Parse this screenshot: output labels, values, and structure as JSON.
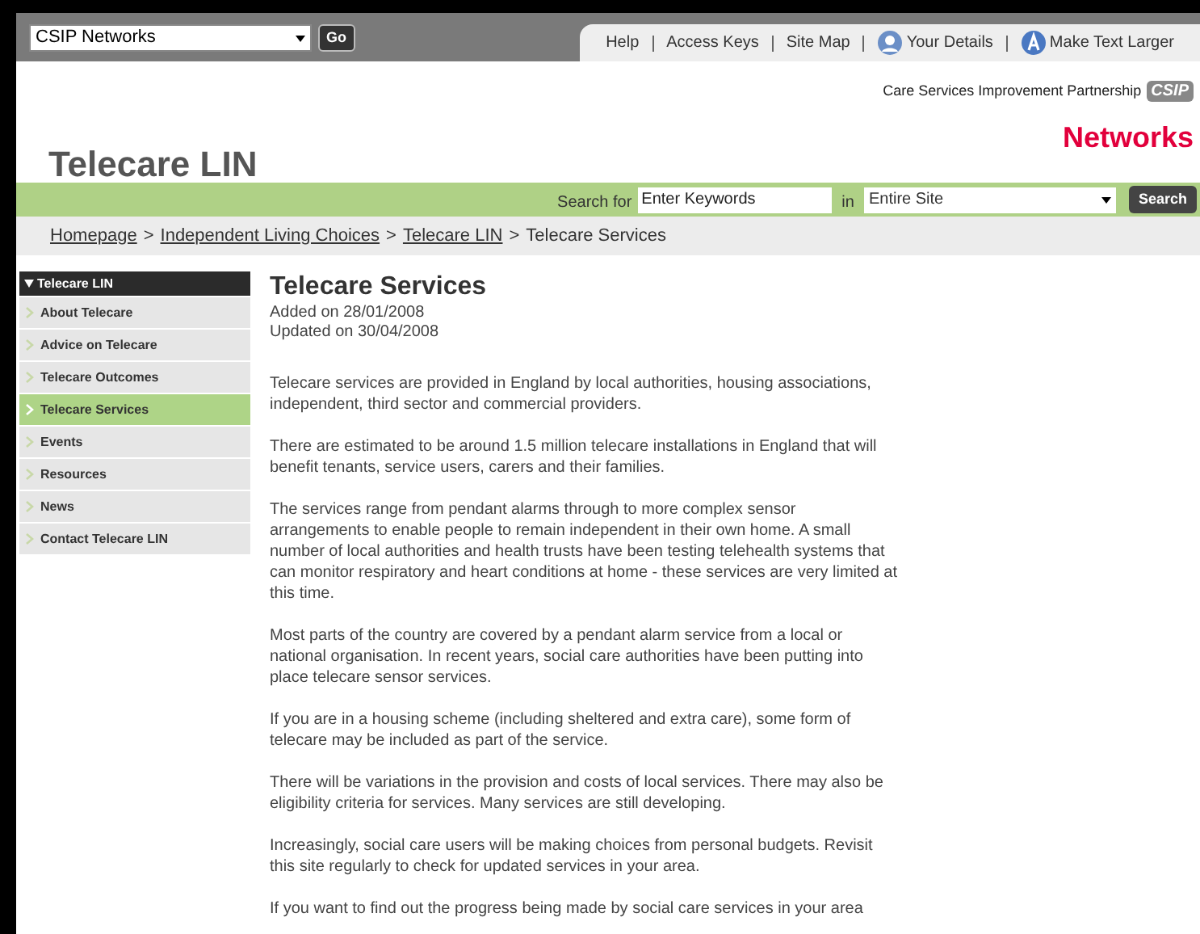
{
  "top_bar": {
    "network_select": {
      "value": "CSIP Networks"
    },
    "go_button": "Go",
    "links": [
      {
        "label": "Help",
        "kind": "plain"
      },
      {
        "label": "Access Keys",
        "kind": "plain"
      },
      {
        "label": "Site Map",
        "kind": "plain"
      },
      {
        "label": "Your Details",
        "kind": "account"
      },
      {
        "label": "Make Text Larger",
        "kind": "textsize"
      }
    ]
  },
  "logo": {
    "tagline": "Care Services Improvement Partnership",
    "badge": "CSIP",
    "name": "Networks"
  },
  "site_title": "Telecare LIN",
  "search": {
    "label": "Search for",
    "placeholder": "Enter Keywords",
    "scope_label": "in",
    "scope": "Entire Site",
    "button": "Search"
  },
  "breadcrumb": [
    {
      "kind": "link",
      "label": "Homepage"
    },
    {
      "kind": "separator",
      "label": ">"
    },
    {
      "kind": "link",
      "label": "Independent Living Choices"
    },
    {
      "kind": "separator",
      "label": ">"
    },
    {
      "kind": "link",
      "label": "Telecare LIN"
    },
    {
      "kind": "separator",
      "label": ">"
    },
    {
      "kind": "current",
      "label": "Telecare Services"
    }
  ],
  "sidebar": {
    "heading": "Telecare LIN",
    "items": [
      {
        "label": "About Telecare",
        "selected": false
      },
      {
        "label": "Advice on Telecare",
        "selected": false
      },
      {
        "label": "Telecare Outcomes",
        "selected": false
      },
      {
        "label": "Telecare Services",
        "selected": true
      },
      {
        "label": "Events",
        "selected": false
      },
      {
        "label": "Resources",
        "selected": false
      },
      {
        "label": "News",
        "selected": false
      },
      {
        "label": "Contact Telecare LIN",
        "selected": false
      }
    ]
  },
  "article": {
    "title": "Telecare Services",
    "added": "Added on 28/01/2008",
    "updated": "Updated on 30/04/2008",
    "paragraphs": [
      "Telecare services are provided in England by local authorities, housing associations, independent, third sector and commercial providers.",
      "There are estimated to be around 1.5 million telecare installations in England that will benefit tenants, service users, carers and their families.",
      "The services range from pendant alarms through to more complex sensor arrangements to enable people to remain independent in their own home. A small number of local authorities and health trusts have been testing telehealth systems that can monitor respiratory and heart conditions at home - these services are very limited at this time.",
      "Most parts of the country are covered by a pendant alarm service from a local or national organisation. In recent years, social care authorities have been putting into place telecare sensor services.",
      "If you are in a housing scheme (including sheltered and extra care), some form of telecare may be included as part of the service.",
      "There will be variations in the provision and costs of local services. There may also be eligibility criteria for services. Many services are still developing.",
      "Increasingly, social care users will be making choices from personal budgets. Revisit this site regularly to check for updated services in your area.",
      "If you want to find out the progress being made by social care services in your area"
    ]
  }
}
